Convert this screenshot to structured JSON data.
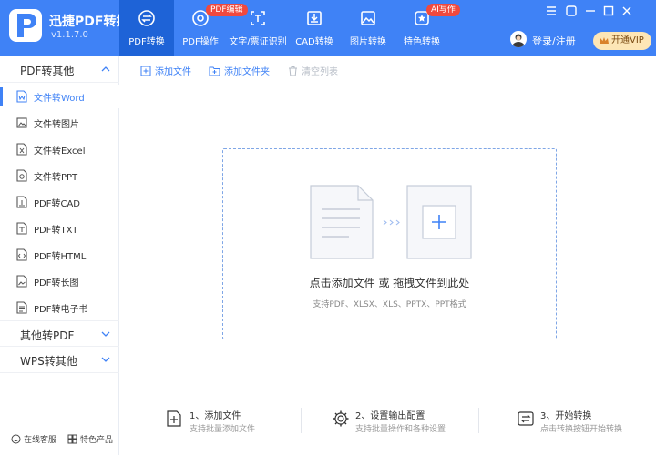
{
  "app": {
    "name": "迅捷PDF转换器",
    "version": "v1.1.7.0"
  },
  "nav": {
    "tabs": [
      {
        "label": "PDF转换",
        "icon": "convert-icon"
      },
      {
        "label": "PDF操作",
        "icon": "settings-circle-icon",
        "badge": "PDF编辑"
      },
      {
        "label": "文字/票证识别",
        "icon": "text-scan-icon"
      },
      {
        "label": "CAD转换",
        "icon": "cad-icon"
      },
      {
        "label": "图片转换",
        "icon": "image-icon"
      },
      {
        "label": "特色转换",
        "icon": "star-icon",
        "badge": "AI写作"
      }
    ],
    "login": "登录/注册",
    "vip": "开通VIP"
  },
  "sidebar": {
    "group_open": "PDF转其他",
    "items": [
      {
        "label": "文件转Word",
        "icon": "word-icon"
      },
      {
        "label": "文件转图片",
        "icon": "image-icon"
      },
      {
        "label": "文件转Excel",
        "icon": "excel-icon"
      },
      {
        "label": "文件转PPT",
        "icon": "ppt-icon"
      },
      {
        "label": "PDF转CAD",
        "icon": "cad-icon"
      },
      {
        "label": "PDF转TXT",
        "icon": "txt-icon"
      },
      {
        "label": "PDF转HTML",
        "icon": "html-icon"
      },
      {
        "label": "PDF转长图",
        "icon": "long-image-icon"
      },
      {
        "label": "PDF转电子书",
        "icon": "ebook-icon"
      }
    ],
    "group2": "其他转PDF",
    "group3": "WPS转其他",
    "footer": {
      "service": "在线客服",
      "products": "特色产品"
    }
  },
  "toolbar": {
    "add_file": "添加文件",
    "add_folder": "添加文件夹",
    "clear": "清空列表"
  },
  "dropzone": {
    "main": "点击添加文件 或 拖拽文件到此处",
    "formats": "支持PDF、XLSX、XLS、PPTX、PPT格式"
  },
  "steps": [
    {
      "title": "1、添加文件",
      "desc": "支持批量添加文件"
    },
    {
      "title": "2、设置输出配置",
      "desc": "支持批量操作和各种设置"
    },
    {
      "title": "3、开始转换",
      "desc": "点击转换按钮开始转换"
    }
  ],
  "colors": {
    "brand": "#3f82f6",
    "brand_dark": "#1e63d7",
    "badge": "#f0493e",
    "vip": "#fde6b6"
  }
}
